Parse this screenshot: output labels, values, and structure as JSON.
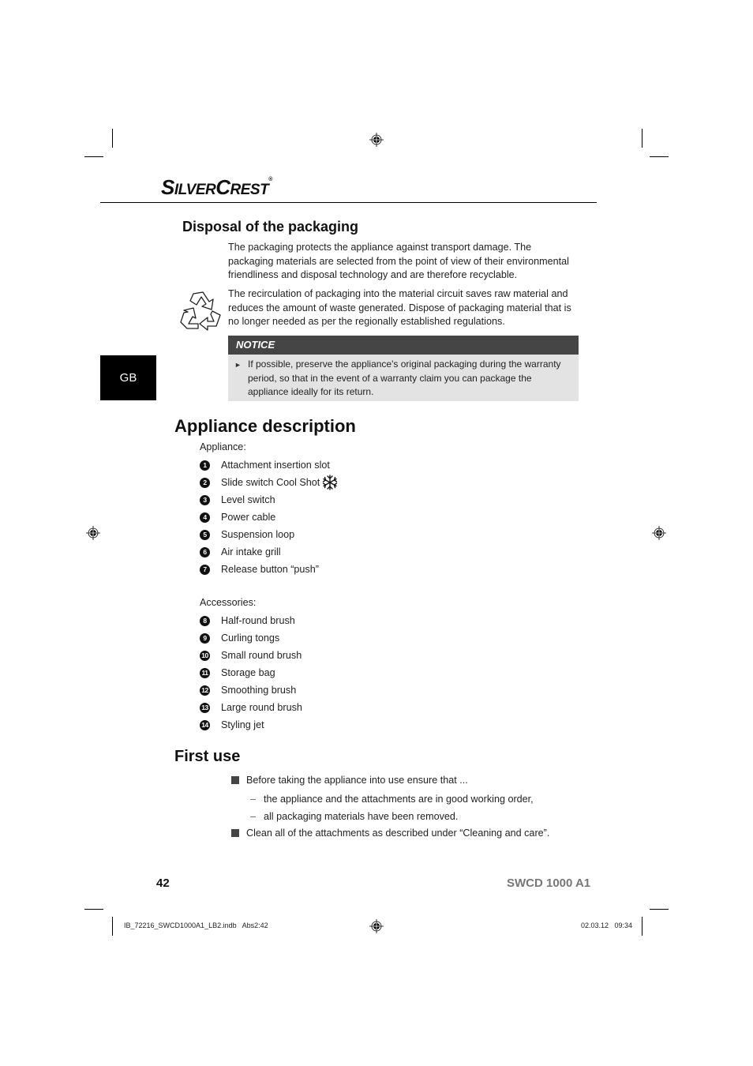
{
  "brand": {
    "logo_s": "S",
    "logo_ilver": "ILVER",
    "logo_c": "C",
    "logo_rest": "REST",
    "registered": "®"
  },
  "language_tab": "GB",
  "disposal": {
    "heading": "Disposal of the packaging",
    "icon": "recycle-icon",
    "paragraph1": "The packaging protects the appliance against transport damage. The packaging materials are selected from the point of view of their environmental friendliness and disposal technology and are therefore recyclable.",
    "paragraph2": "The recirculation of packaging into the material circuit saves raw material and reduces the amount of waste generated. Dispose of packaging material that is no longer needed as per the regionally established regulations.",
    "notice": {
      "label": "NOTICE",
      "bullet_icon": "triangle-right-icon",
      "text": "If possible, preserve the appliance's original packaging during the warranty period, so that in the event of a warranty claim you can package the appliance ideally for its return."
    }
  },
  "appliance_description": {
    "heading": "Appliance description",
    "appliance_label": "Appliance:",
    "appliance_items": [
      {
        "num": "1",
        "label": "Attachment insertion slot"
      },
      {
        "num": "2",
        "label": "Slide switch Cool Shot",
        "icon": "snowflake-icon"
      },
      {
        "num": "3",
        "label": "Level switch"
      },
      {
        "num": "4",
        "label": "Power cable"
      },
      {
        "num": "5",
        "label": "Suspension loop"
      },
      {
        "num": "6",
        "label": "Air intake grill"
      },
      {
        "num": "7",
        "label": "Release button “push”"
      }
    ],
    "accessories_label": "Accessories:",
    "accessory_items": [
      {
        "num": "8",
        "label": "Half-round brush"
      },
      {
        "num": "9",
        "label": "Curling tongs"
      },
      {
        "num": "10",
        "label": "Small round brush"
      },
      {
        "num": "11",
        "label": "Storage bag"
      },
      {
        "num": "12",
        "label": "Smoothing brush"
      },
      {
        "num": "13",
        "label": "Large round brush"
      },
      {
        "num": "14",
        "label": "Styling jet"
      }
    ]
  },
  "first_use": {
    "heading": "First use",
    "bullet1": "Before taking the appliance into use ensure that ...",
    "dash1": "the appliance and the attachments are in good working order,",
    "dash2": "all packaging materials have been removed.",
    "bullet2": "Clean all of the attachments as described under “Cleaning and care”.",
    "dash_char": "–"
  },
  "footer": {
    "page_number": "42",
    "model": "SWCD 1000 A1",
    "slug_file": "IB_72216_SWCD1000A1_LB2.indb   Abs2:42",
    "slug_date": "02.03.12   09:34"
  }
}
